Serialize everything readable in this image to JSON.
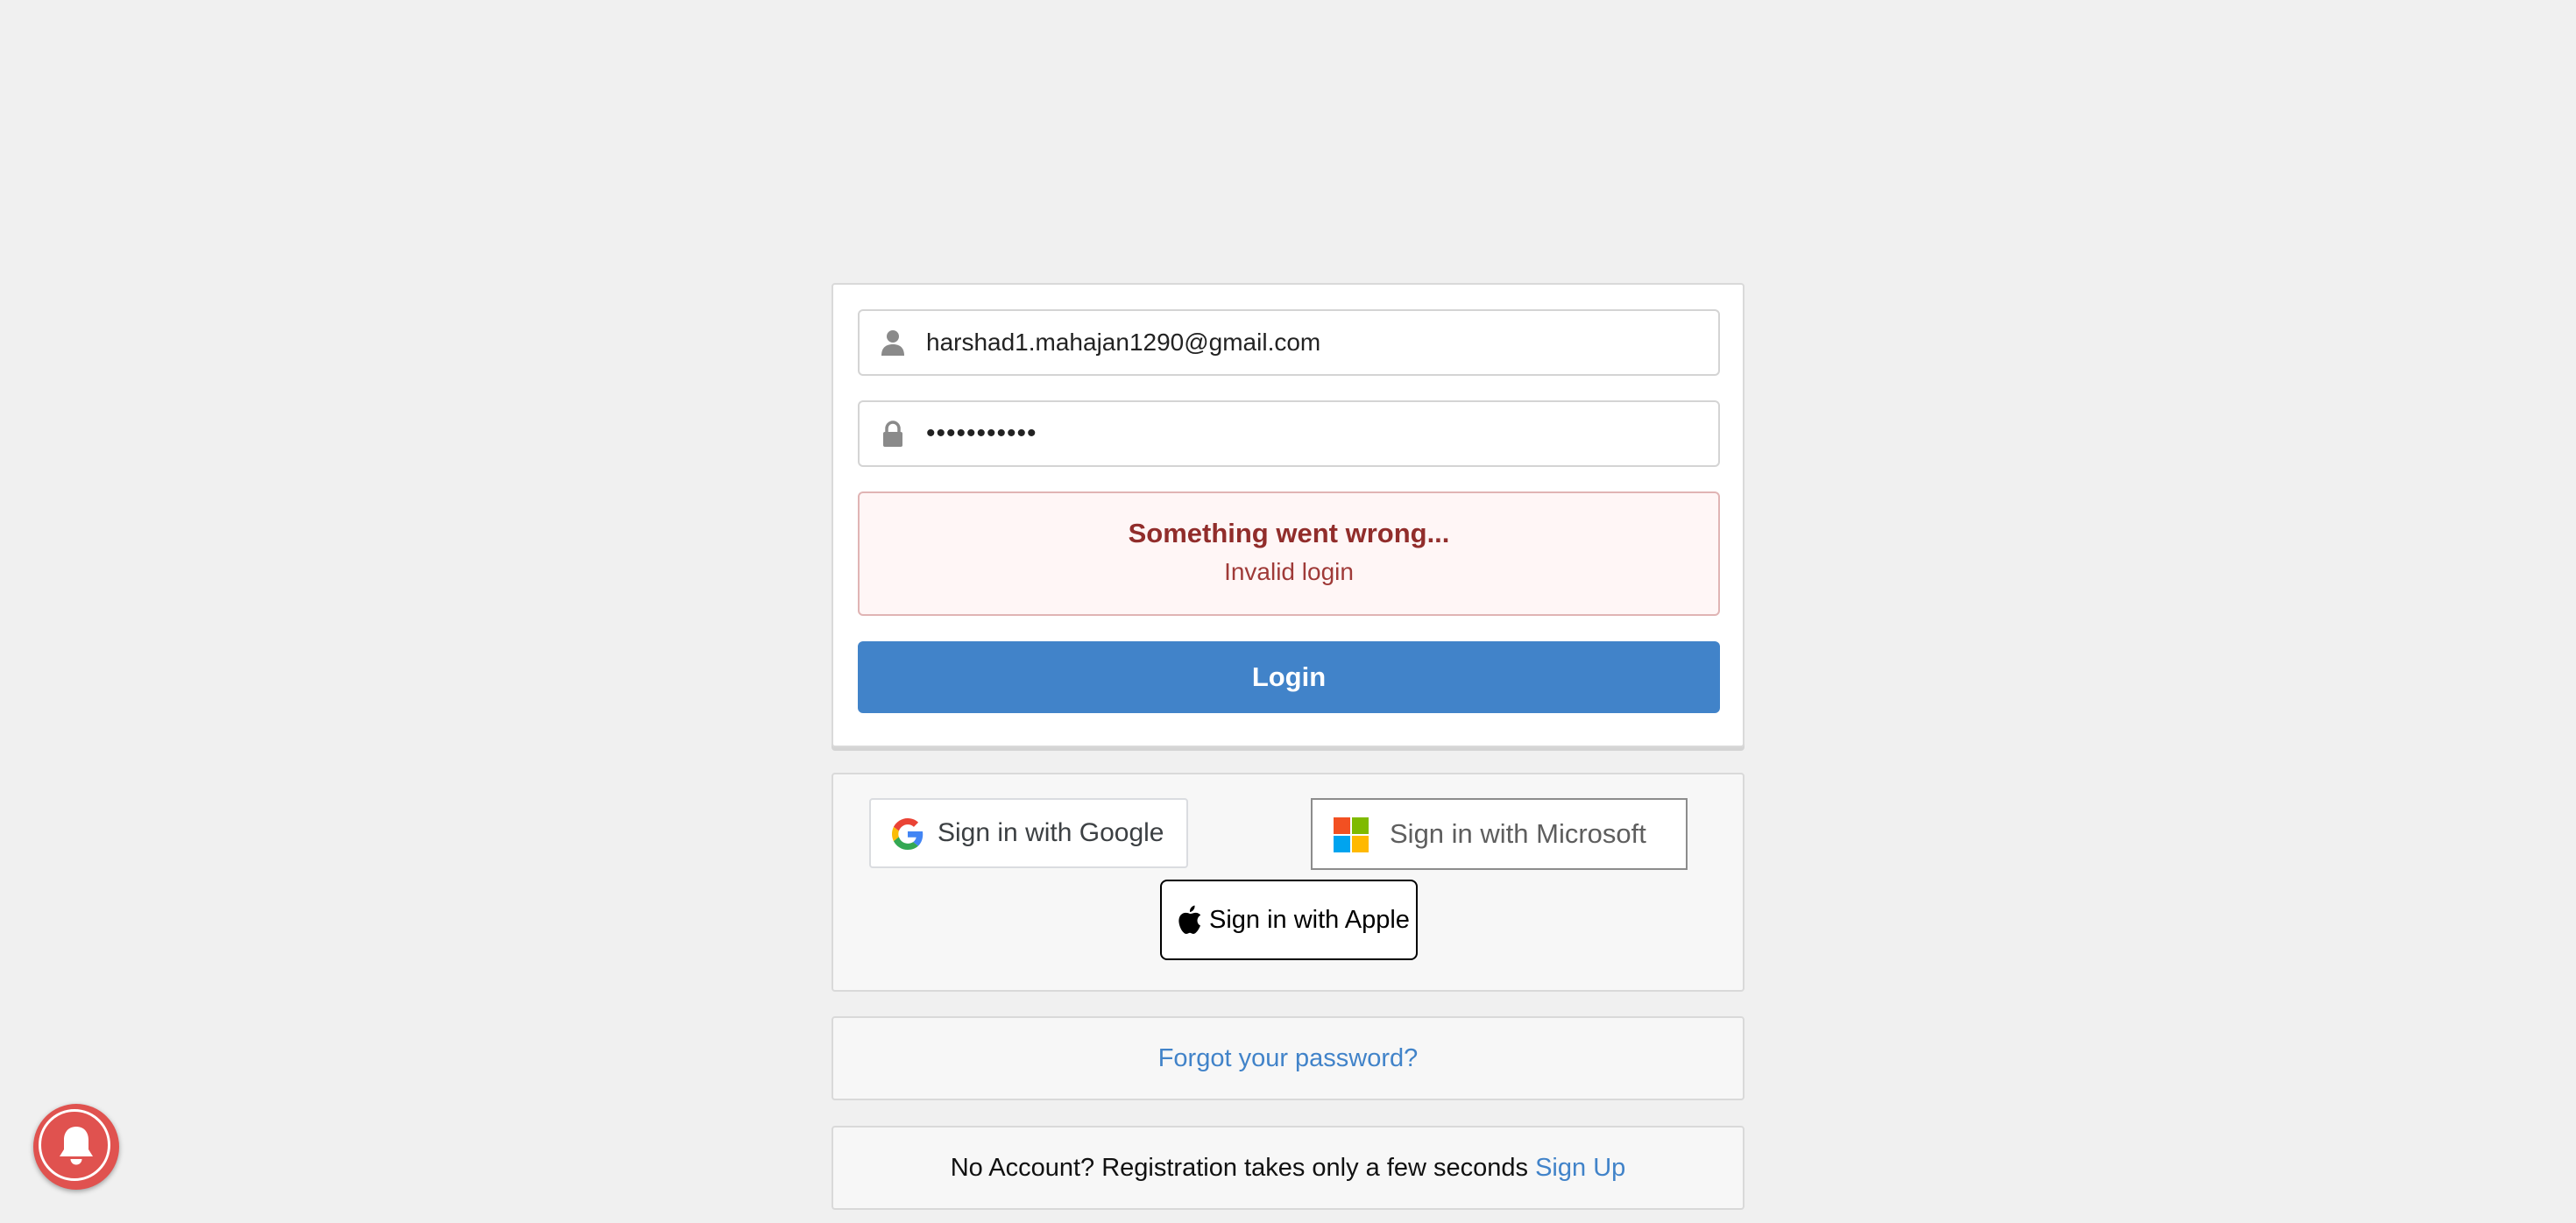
{
  "login_form": {
    "email_value": "harshad1.mahajan1290@gmail.com",
    "email_icon": "user-icon",
    "password_masked": "•••••••••••",
    "password_icon": "lock-icon",
    "error": {
      "title": "Something went wrong...",
      "detail": "Invalid login"
    },
    "login_button_label": "Login"
  },
  "social_login": {
    "google_label": "Sign in with Google",
    "google_icon": "google-icon",
    "microsoft_label": "Sign in with Microsoft",
    "microsoft_icon": "microsoft-icon",
    "apple_label": "Sign in with Apple",
    "apple_icon": "apple-icon"
  },
  "forgot_password": {
    "link_label": "Forgot your password?"
  },
  "signup": {
    "prompt": "No Account? Registration takes only a few seconds",
    "link_label": "Sign Up"
  },
  "notification": {
    "icon": "bell-icon"
  },
  "colors": {
    "page_background": "#f0f0f0",
    "primary": "#4183c9",
    "error_text": "#912d2b",
    "error_background": "#fff6f6",
    "error_border": "#e0b4b4",
    "notification": "#e0524f"
  }
}
